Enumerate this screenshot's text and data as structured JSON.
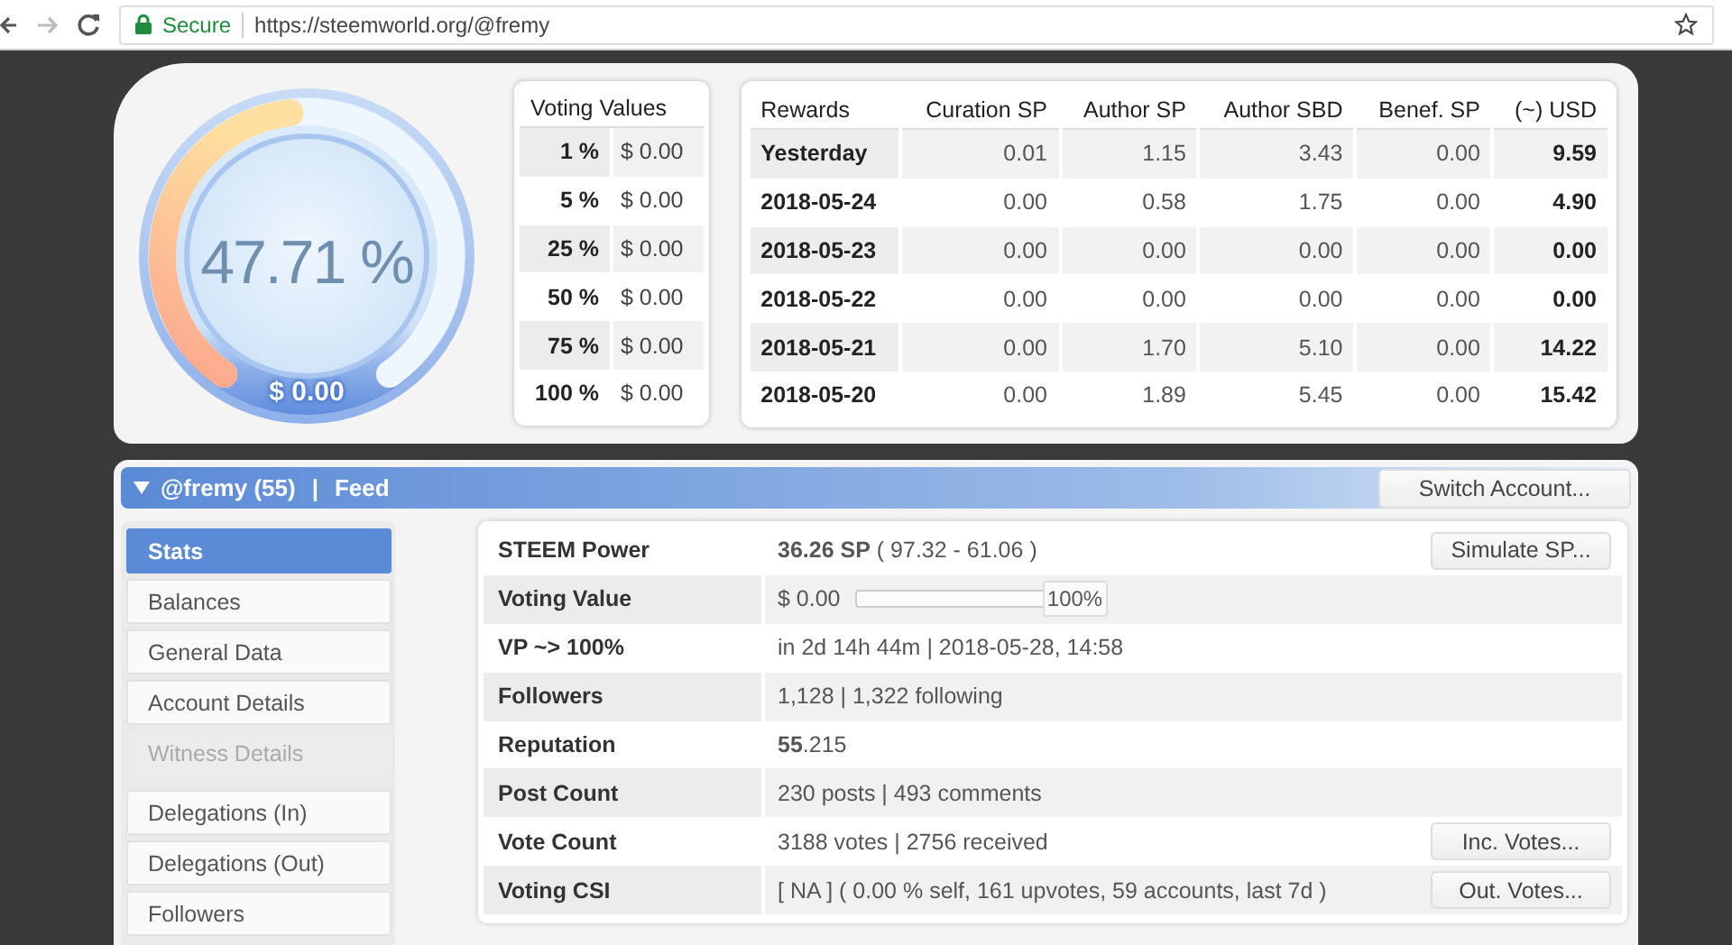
{
  "browser": {
    "secure_label": "Secure",
    "url": "https://steemworld.org/@fremy"
  },
  "gauge": {
    "percent": "47.71 %",
    "value": "$ 0.00",
    "level": 0.4771
  },
  "voting_values": {
    "title": "Voting Values",
    "rows": [
      {
        "weight": "1 %",
        "value": "$ 0.00"
      },
      {
        "weight": "5 %",
        "value": "$ 0.00"
      },
      {
        "weight": "25 %",
        "value": "$ 0.00"
      },
      {
        "weight": "50 %",
        "value": "$ 0.00"
      },
      {
        "weight": "75 %",
        "value": "$ 0.00"
      },
      {
        "weight": "100 %",
        "value": "$ 0.00"
      }
    ]
  },
  "rewards": {
    "columns": [
      "Rewards",
      "Curation SP",
      "Author SP",
      "Author SBD",
      "Benef. SP",
      "(~) USD"
    ],
    "rows": [
      [
        "Yesterday",
        "0.01",
        "1.15",
        "3.43",
        "0.00",
        "9.59"
      ],
      [
        "2018-05-24",
        "0.00",
        "0.58",
        "1.75",
        "0.00",
        "4.90"
      ],
      [
        "2018-05-23",
        "0.00",
        "0.00",
        "0.00",
        "0.00",
        "0.00"
      ],
      [
        "2018-05-22",
        "0.00",
        "0.00",
        "0.00",
        "0.00",
        "0.00"
      ],
      [
        "2018-05-21",
        "0.00",
        "1.70",
        "5.10",
        "0.00",
        "14.22"
      ],
      [
        "2018-05-20",
        "0.00",
        "1.89",
        "5.45",
        "0.00",
        "15.42"
      ]
    ]
  },
  "account_bar": {
    "account": "@fremy (55)",
    "separator": "|",
    "feed": "Feed",
    "switch_button": "Switch Account..."
  },
  "sidebar": {
    "items": [
      {
        "label": "Stats",
        "selected": true,
        "disabled": false
      },
      {
        "label": "Balances",
        "selected": false,
        "disabled": false
      },
      {
        "label": "General Data",
        "selected": false,
        "disabled": false
      },
      {
        "label": "Account Details",
        "selected": false,
        "disabled": false
      },
      {
        "label": "Witness Details",
        "selected": false,
        "disabled": true
      },
      {
        "label": "Delegations (In)",
        "selected": false,
        "disabled": false
      },
      {
        "label": "Delegations (Out)",
        "selected": false,
        "disabled": false
      },
      {
        "label": "Followers",
        "selected": false,
        "disabled": false
      }
    ]
  },
  "stats": [
    {
      "kind": "text",
      "label": "STEEM Power",
      "value": "**36.26 SP** ( 97.32 - 61.06 )",
      "button": "Simulate SP..."
    },
    {
      "kind": "slider",
      "label": "Voting Value",
      "value": "$ 0.00",
      "level": 1,
      "reading": "100%"
    },
    {
      "kind": "text",
      "label": "VP ~> 100%",
      "value": "in 2d 14h 44m | 2018-05-28, 14:58"
    },
    {
      "kind": "text",
      "label": "Followers",
      "value": "1,128 | 1,322 following"
    },
    {
      "kind": "text",
      "label": "Reputation",
      "value": "**55**.215"
    },
    {
      "kind": "text",
      "label": "Post Count",
      "value": "230 posts | 493 comments"
    },
    {
      "kind": "text",
      "label": "Vote Count",
      "value": "3188 votes | 2756 received",
      "button": "Inc. Votes..."
    },
    {
      "kind": "text",
      "label": "Voting CSI",
      "value": "[ NA ] ( 0.00 % self, 161 upvotes, 59 accounts, last 7d )",
      "button": "Out. Votes..."
    }
  ]
}
